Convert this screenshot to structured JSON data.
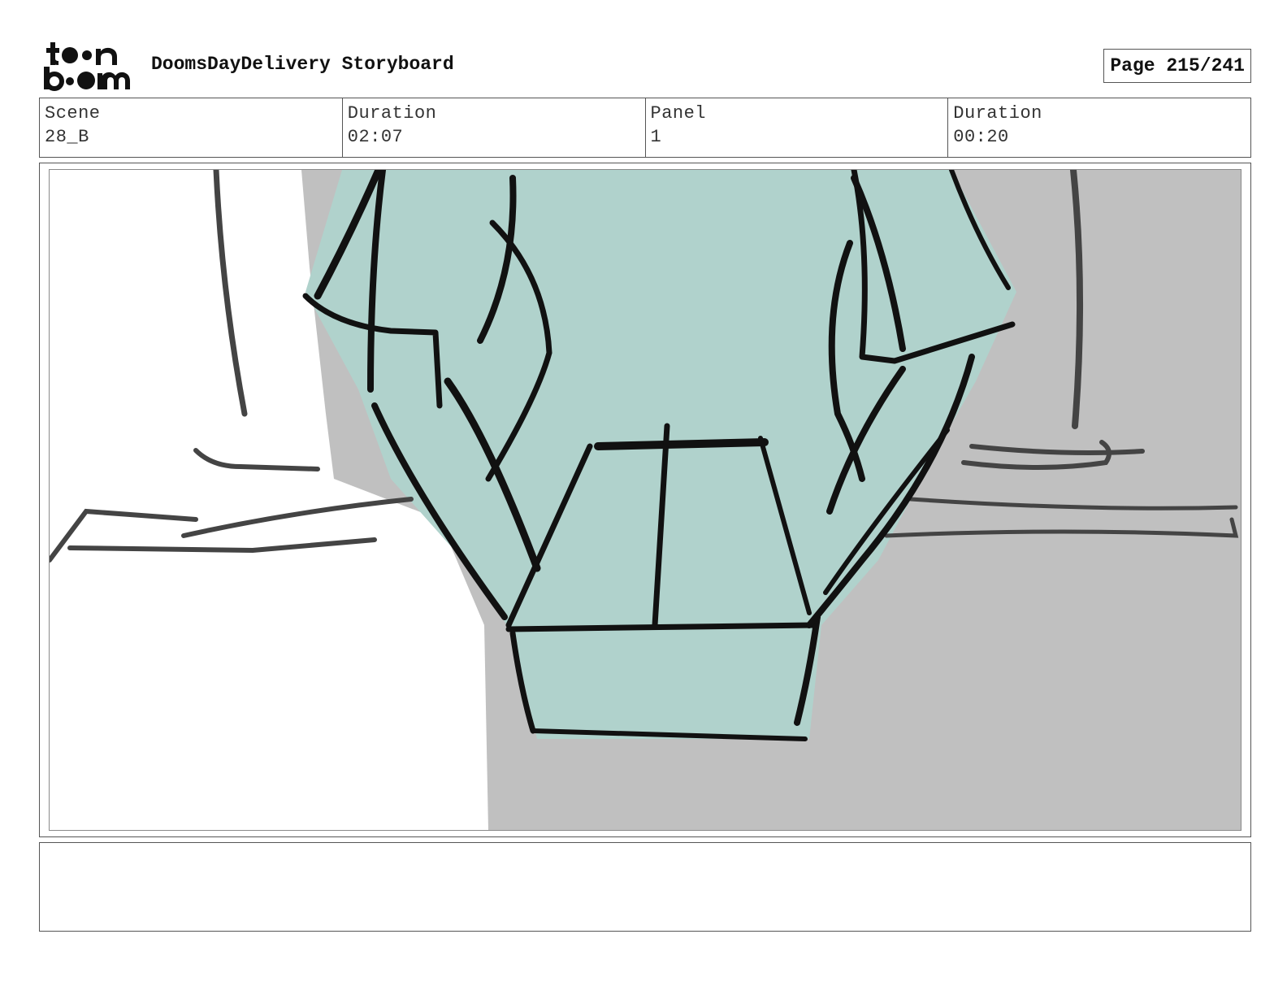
{
  "logo": {
    "line1": "toon",
    "line2": "boom",
    "icon": "toonboom-logo"
  },
  "document": {
    "title": "DoomsDayDelivery Storyboard",
    "page": "Page 215/241"
  },
  "info": {
    "scene_label": "Scene",
    "scene_value": "28_B",
    "scene_duration_label": "Duration",
    "scene_duration_value": "02:07",
    "panel_label": "Panel",
    "panel_value": "1",
    "panel_duration_label": "Duration",
    "panel_duration_value": "00:20"
  },
  "panel_image": {
    "description_icon": "sketch-drawing",
    "colors": {
      "background_gray": "#c0c0c0",
      "figure_teal": "#b0d2cc",
      "ink": "#111111"
    }
  },
  "notes": {
    "text": ""
  }
}
